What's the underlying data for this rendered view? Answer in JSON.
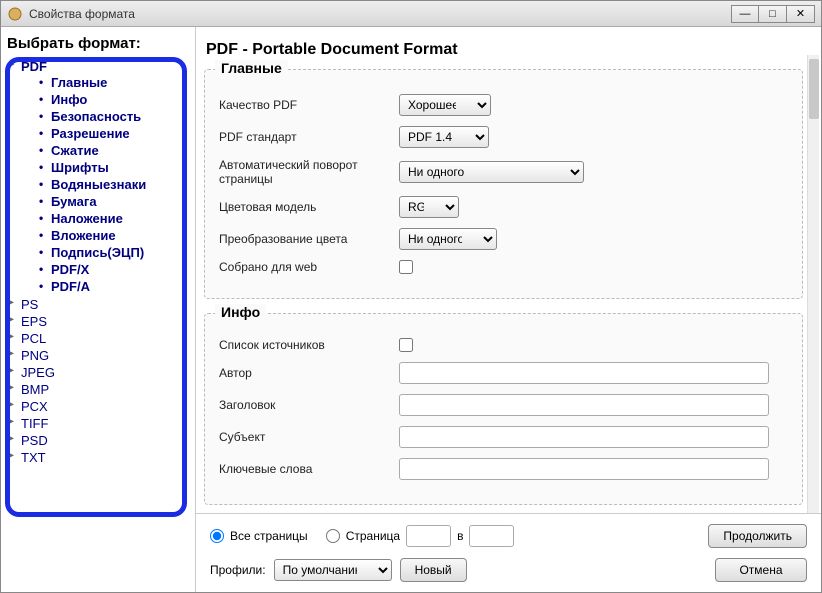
{
  "window": {
    "title": "Свойства формата"
  },
  "sidebar": {
    "heading": "Выбрать формат:",
    "pdf": {
      "label": "PDF",
      "items": [
        {
          "label": "Главные"
        },
        {
          "label": "Инфо"
        },
        {
          "label": "Безопасность"
        },
        {
          "label": "Разрешение"
        },
        {
          "label": "Сжатие"
        },
        {
          "label": "Шрифты"
        },
        {
          "label": "Водяныезнаки"
        },
        {
          "label": "Бумага"
        },
        {
          "label": "Наложение"
        },
        {
          "label": "Вложение"
        },
        {
          "label": "Подпись(ЭЦП)"
        },
        {
          "label": "PDF/X"
        },
        {
          "label": "PDF/A"
        }
      ]
    },
    "other": [
      {
        "label": "PS"
      },
      {
        "label": "EPS"
      },
      {
        "label": "PCL"
      },
      {
        "label": "PNG"
      },
      {
        "label": "JPEG"
      },
      {
        "label": "BMP"
      },
      {
        "label": "PCX"
      },
      {
        "label": "TIFF"
      },
      {
        "label": "PSD"
      },
      {
        "label": "TXT"
      }
    ]
  },
  "main": {
    "title": "PDF - Portable Document Format",
    "section_main": {
      "legend": "Главные",
      "quality_label": "Качество PDF",
      "quality_value": "Хорошее",
      "standard_label": "PDF стандарт",
      "standard_value": "PDF 1.4",
      "autorotate_label": "Автоматический поворот страницы",
      "autorotate_value": "Ни одного",
      "colormodel_label": "Цветовая модель",
      "colormodel_value": "RGB",
      "colortransform_label": "Преобразование цвета",
      "colortransform_value": "Ни одного",
      "webcollect_label": "Собрано для web"
    },
    "section_info": {
      "legend": "Инфо",
      "sourcelist_label": "Список источников",
      "author_label": "Автор",
      "author_value": "",
      "title_label": "Заголовок",
      "title_value": "",
      "subject_label": "Субъект",
      "subject_value": "",
      "keywords_label": "Ключевые слова",
      "keywords_value": ""
    }
  },
  "footer": {
    "all_pages": "Все страницы",
    "page_label": "Страница",
    "in_label": "в",
    "profiles_label": "Профили:",
    "profile_value": "По умолчанию",
    "new_btn": "Новый",
    "continue_btn": "Продолжить",
    "cancel_btn": "Отмена"
  }
}
